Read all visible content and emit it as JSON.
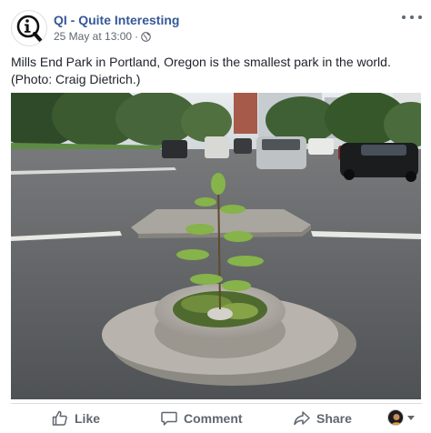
{
  "post": {
    "page_name": "QI - Quite Interesting",
    "timestamp": "25 May at 13:00",
    "separator": "·",
    "audience_icon": "globe-icon",
    "text_line1": "Mills End Park in Portland, Oregon is the smallest park in the world.",
    "text_line2": "(Photo: Craig Dietrich.)",
    "photo_alt": "Mills End Park in the median of a Portland street"
  },
  "actions": {
    "like_label": "Like",
    "comment_label": "Comment",
    "share_label": "Share",
    "like_icon": "thumbs-up-icon",
    "comment_icon": "speech-bubble-icon",
    "share_icon": "share-arrow-icon"
  },
  "colors": {
    "page_name": "#365899",
    "meta_text": "#616770",
    "action_text": "#606770",
    "divider": "#dadde1"
  }
}
